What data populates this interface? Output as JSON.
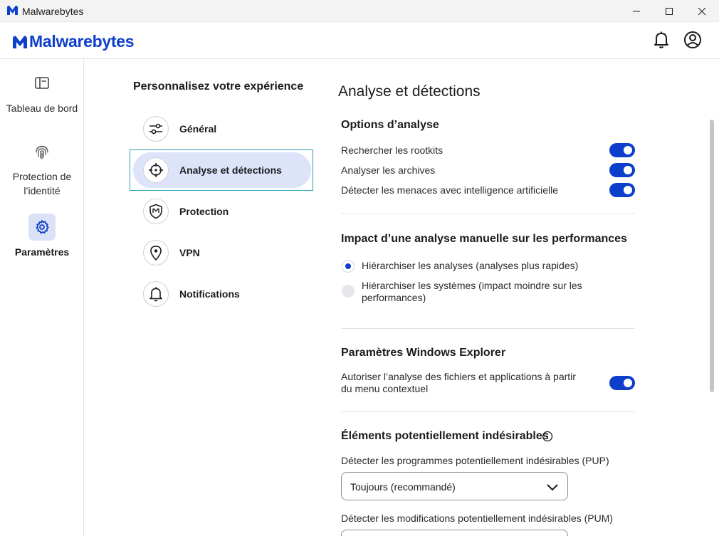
{
  "window": {
    "title": "Malwarebytes"
  },
  "header": {
    "brand": "Malwarebytes"
  },
  "sidebar": {
    "items": [
      {
        "label": "Tableau de bord",
        "icon": "dashboard-icon"
      },
      {
        "label": "Protection de l’identité",
        "icon": "fingerprint-icon"
      },
      {
        "label": "Paramètres",
        "icon": "gear-icon",
        "active": true
      }
    ]
  },
  "settings_menu": {
    "title": "Personnalisez votre expérience",
    "items": [
      {
        "label": "Général",
        "icon": "sliders-icon"
      },
      {
        "label": "Analyse et détections",
        "icon": "crosshair-icon",
        "active": true
      },
      {
        "label": "Protection",
        "icon": "shield-icon"
      },
      {
        "label": "VPN",
        "icon": "location-pin-icon"
      },
      {
        "label": "Notifications",
        "icon": "bell-icon"
      }
    ]
  },
  "content": {
    "title": "Analyse et détections",
    "scan_options": {
      "title": "Options d’analyse",
      "items": [
        {
          "label": "Rechercher les rootkits",
          "enabled": true
        },
        {
          "label": "Analyser les archives",
          "enabled": true
        },
        {
          "label": "Détecter les menaces avec intelligence artificielle",
          "enabled": true
        }
      ]
    },
    "performance": {
      "title": "Impact d’une analyse manuelle sur les performances",
      "options": [
        {
          "label": "Hiérarchiser les analyses (analyses plus rapides)",
          "selected": true
        },
        {
          "label_line1": "Hiérarchiser les systèmes (impact moindre sur les",
          "label_line2": "performances)",
          "selected": false
        }
      ]
    },
    "explorer": {
      "title": "Paramètres Windows Explorer",
      "item_line1": "Autoriser l’analyse des fichiers et applications à partir",
      "item_line2": "du menu contextuel",
      "enabled": true
    },
    "pup": {
      "title": "Éléments potentiellement indésirables",
      "pup_label": "Détecter les programmes potentiellement indésirables (PUP)",
      "pup_value": "Toujours (recommandé)",
      "pum_label": "Détecter les modifications potentiellement indésirables (PUM)"
    }
  },
  "colors": {
    "accent": "#0d3ecc",
    "active_bg": "#dde3f8"
  }
}
